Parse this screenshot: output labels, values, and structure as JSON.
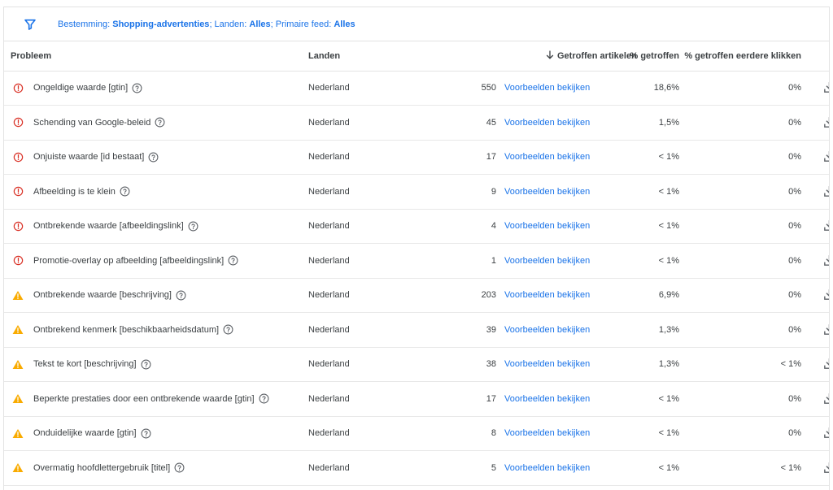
{
  "filter": {
    "destination_label": "Bestemming: ",
    "destination_value": "Shopping-advertenties",
    "countries_label": "; Landen: ",
    "countries_value": "Alles",
    "feed_label": "; Primaire feed: ",
    "feed_value": "Alles",
    "icon": "filter-icon",
    "accent_color": "#1a73e8"
  },
  "table": {
    "headers": {
      "problem": "Probleem",
      "countries": "Landen",
      "affected_items": "Getroffen artikelen",
      "pct_affected": "% getroffen",
      "pct_clicks": "% getroffen eerdere klikken"
    },
    "rows": [
      {
        "severity": "error",
        "problem": "Ongeldige waarde [gtin]",
        "country": "Nederland",
        "count": "550",
        "link": "Voorbeelden bekijken",
        "pct": "18,6%",
        "pct_clicks": "0%"
      },
      {
        "severity": "error",
        "problem": "Schending van Google-beleid",
        "country": "Nederland",
        "count": "45",
        "link": "Voorbeelden bekijken",
        "pct": "1,5%",
        "pct_clicks": "0%"
      },
      {
        "severity": "error",
        "problem": "Onjuiste waarde [id bestaat]",
        "country": "Nederland",
        "count": "17",
        "link": "Voorbeelden bekijken",
        "pct": "< 1%",
        "pct_clicks": "0%"
      },
      {
        "severity": "error",
        "problem": "Afbeelding is te klein",
        "country": "Nederland",
        "count": "9",
        "link": "Voorbeelden bekijken",
        "pct": "< 1%",
        "pct_clicks": "0%"
      },
      {
        "severity": "error",
        "problem": "Ontbrekende waarde [afbeeldingslink]",
        "country": "Nederland",
        "count": "4",
        "link": "Voorbeelden bekijken",
        "pct": "< 1%",
        "pct_clicks": "0%"
      },
      {
        "severity": "error",
        "problem": "Promotie-overlay op afbeelding [afbeeldingslink]",
        "country": "Nederland",
        "count": "1",
        "link": "Voorbeelden bekijken",
        "pct": "< 1%",
        "pct_clicks": "0%"
      },
      {
        "severity": "warning",
        "problem": "Ontbrekende waarde [beschrijving]",
        "country": "Nederland",
        "count": "203",
        "link": "Voorbeelden bekijken",
        "pct": "6,9%",
        "pct_clicks": "0%"
      },
      {
        "severity": "warning",
        "problem": "Ontbrekend kenmerk [beschikbaarheidsdatum]",
        "country": "Nederland",
        "count": "39",
        "link": "Voorbeelden bekijken",
        "pct": "1,3%",
        "pct_clicks": "0%"
      },
      {
        "severity": "warning",
        "problem": "Tekst te kort [beschrijving]",
        "country": "Nederland",
        "count": "38",
        "link": "Voorbeelden bekijken",
        "pct": "1,3%",
        "pct_clicks": "< 1%"
      },
      {
        "severity": "warning",
        "problem": "Beperkte prestaties door een ontbrekende waarde [gtin]",
        "country": "Nederland",
        "count": "17",
        "link": "Voorbeelden bekijken",
        "pct": "< 1%",
        "pct_clicks": "0%"
      },
      {
        "severity": "warning",
        "problem": "Onduidelijke waarde [gtin]",
        "country": "Nederland",
        "count": "8",
        "link": "Voorbeelden bekijken",
        "pct": "< 1%",
        "pct_clicks": "0%"
      },
      {
        "severity": "warning",
        "problem": "Overmatig hoofdlettergebruik [titel]",
        "country": "Nederland",
        "count": "5",
        "link": "Voorbeelden bekijken",
        "pct": "< 1%",
        "pct_clicks": "< 1%"
      }
    ]
  },
  "colors": {
    "error": "#d93025",
    "warning": "#f9ab00",
    "link": "#1a73e8",
    "icon_gray": "#5f6368"
  },
  "icons": {
    "error": "error-circle-icon",
    "warning": "warning-triangle-icon",
    "help": "help-circle-icon",
    "download": "download-icon",
    "sort": "arrow-down-icon"
  }
}
